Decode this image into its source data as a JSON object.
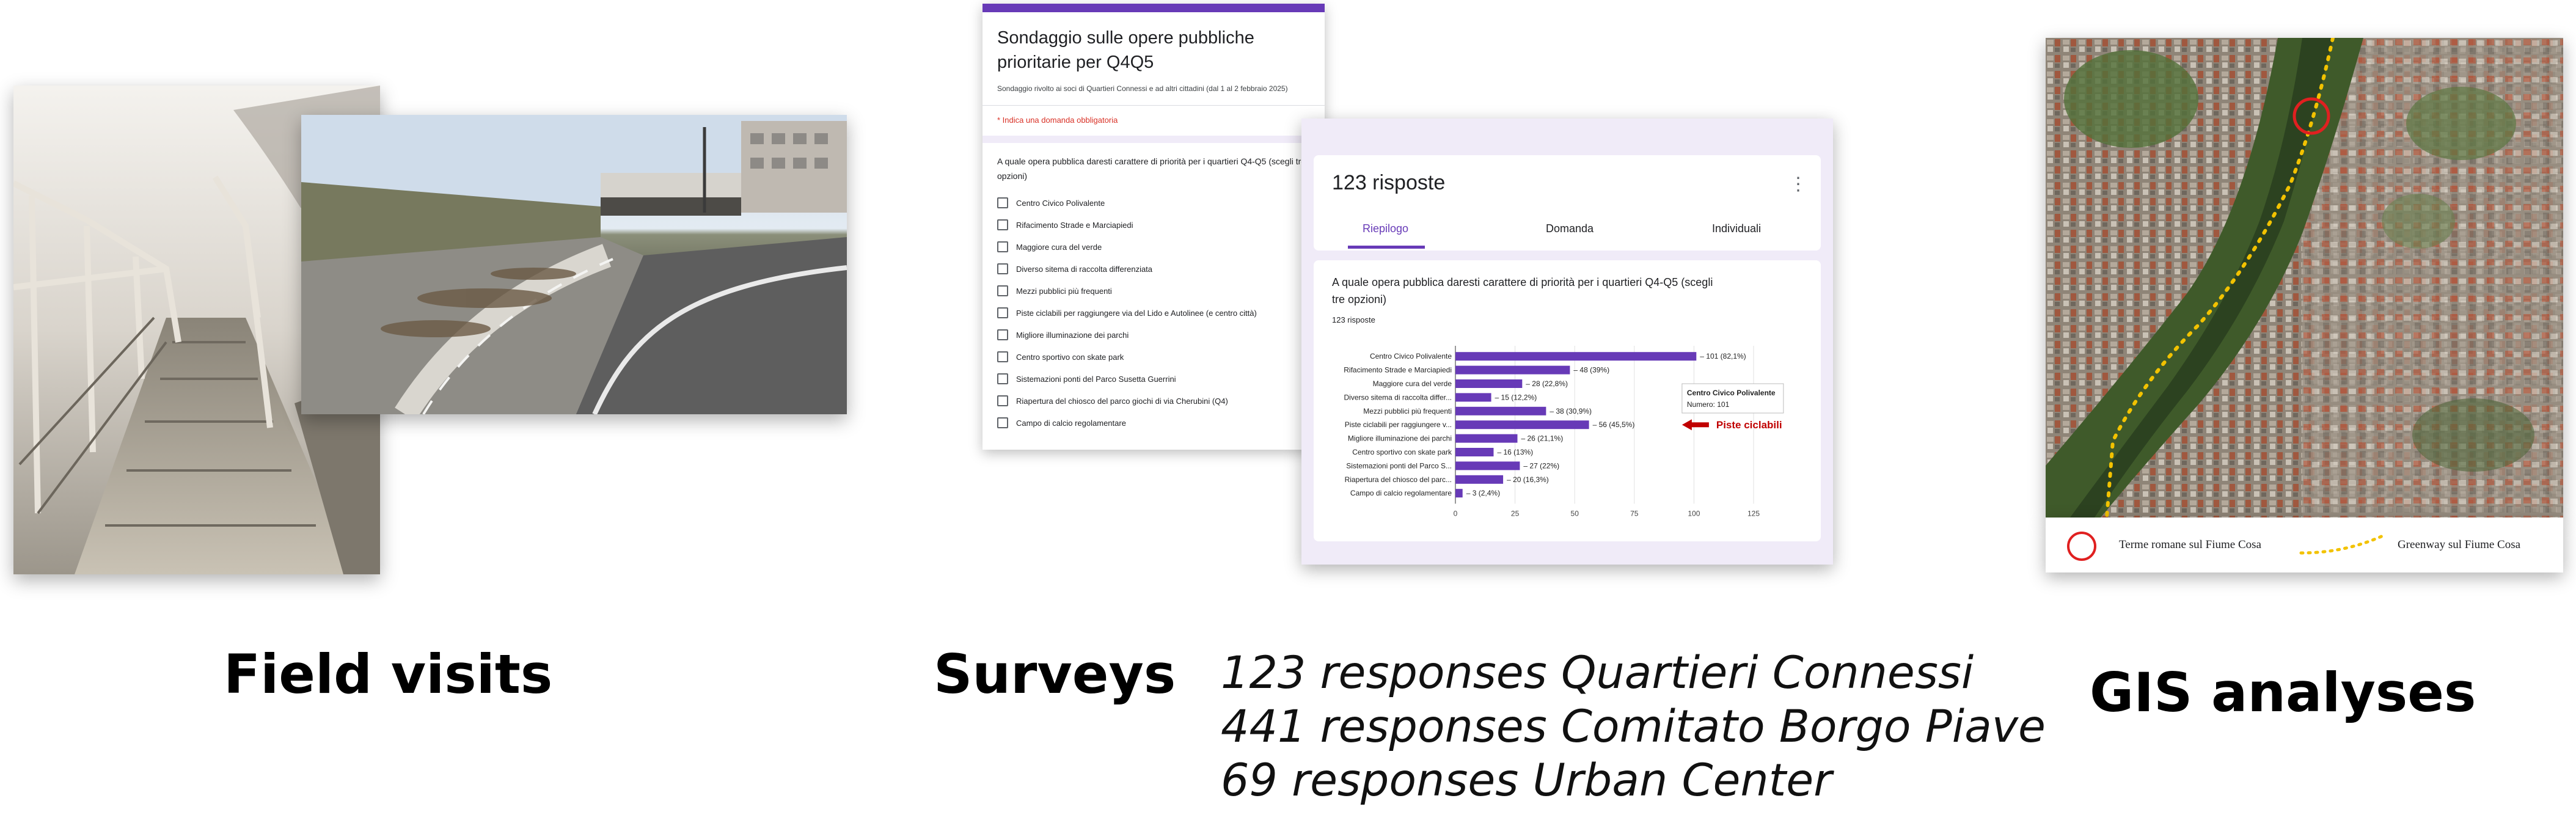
{
  "captions": {
    "field_visits": "Field visits",
    "surveys": "Surveys",
    "gis_analyses": "GIS analyses"
  },
  "survey_responses": [
    "123 responses Quartieri Connessi",
    "441 responses Comitato Borgo Piave",
    "69 responses Urban Center"
  ],
  "form": {
    "title": "Sondaggio sulle opere pubbliche prioritarie per Q4Q5",
    "subtitle": "Sondaggio rivolto ai soci di Quartieri Connessi e ad altri cittadini (dal 1 al 2 febbraio 2025)",
    "required_note": "* Indica una domanda obbligatoria",
    "question": "A quale opera pubblica daresti carattere di priorità per i quartieri Q4-Q5 (scegli tre opzioni)",
    "options": [
      "Centro Civico Polivalente",
      "Rifacimento Strade e Marciapiedi",
      "Maggiore cura del verde",
      "Diverso sitema di raccolta differenziata",
      "Mezzi pubblici più frequenti",
      "Piste ciclabili per raggiungere via del Lido e Autolinee (e centro città)",
      "Migliore illuminazione dei parchi",
      "Centro sportivo con skate park",
      "Sistemazioni ponti del Parco Susetta Guerrini",
      "Riapertura del chiosco del parco giochi di via Cherubini (Q4)",
      "Campo di calcio regolamentare"
    ],
    "accent_color": "#673ab7"
  },
  "results": {
    "count_title": "123 risposte",
    "more_icon": "more-vert-icon",
    "tabs": [
      "Riepilogo",
      "Domanda",
      "Individuali"
    ],
    "active_tab": "Riepilogo",
    "question": "A quale opera pubblica daresti carattere di priorità per i quartieri Q4-Q5 (scegli tre opzioni)",
    "n_responses": "123 risposte",
    "tooltip": {
      "title": "Centro Civico Polivalente",
      "label": "Numero:",
      "value": "101"
    },
    "annotation": "Piste ciclabili",
    "annotation_color": "#c00000"
  },
  "chart_data": {
    "type": "bar",
    "orientation": "horizontal",
    "categories": [
      "Centro Civico Polivalente",
      "Rifacimento Strade e Marciapiedi",
      "Maggiore cura del verde",
      "Diverso sitema di raccolta differ...",
      "Mezzi pubblici più frequenti",
      "Piste ciclabili per raggiungere v...",
      "Migliore illuminazione dei parchi",
      "Centro sportivo con skate park",
      "Sistemazioni ponti del Parco S...",
      "Riapertura del chiosco del parc...",
      "Campo di calcio regolamentare"
    ],
    "values": [
      101,
      48,
      28,
      15,
      38,
      56,
      26,
      16,
      27,
      20,
      3
    ],
    "data_labels": [
      "101 (82,1%)",
      "48 (39%)",
      "28 (22,8%)",
      "15 (12,2%)",
      "38 (30,9%)",
      "56 (45,5%)",
      "26 (21,1%)",
      "16 (13%)",
      "27 (22%)",
      "20 (16,3%)",
      "3 (2,4%)"
    ],
    "xlim": [
      0,
      125
    ],
    "xticks": [
      0,
      25,
      50,
      75,
      100,
      125
    ],
    "grid": true,
    "bar_color": "#673ab7"
  },
  "map": {
    "legend": [
      {
        "icon": "red-circle-icon",
        "label": "Terme romane sul Fiume Cosa",
        "color": "#e02020"
      },
      {
        "icon": "yellow-dotted-line-icon",
        "label": "Greenway sul Fiume Cosa",
        "color": "#f2c200"
      }
    ]
  }
}
